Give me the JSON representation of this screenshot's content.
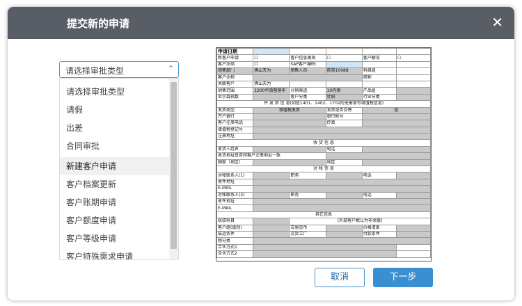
{
  "dialog": {
    "title": "提交新的申请",
    "close_icon": "close-icon",
    "close_glyph": "✕"
  },
  "approval_type": {
    "selected": "请选择审批类型",
    "caret": "⌃",
    "options": [
      "请选择审批类型",
      "请假",
      "出差",
      "合同审批",
      "新建客户申请",
      "客户档案更新",
      "客户账期申请",
      "客户额度申请",
      "客户等级申请",
      "客户特殊需求申请"
    ],
    "highlighted_index": 4
  },
  "form": {
    "r1": [
      "申请日期",
      "",
      "",
      "",
      "",
      ""
    ],
    "r2": [
      "新客户申请",
      "☐",
      "客户信息更改",
      "☐",
      "客户解冻",
      "☐"
    ],
    "r3": [
      "客户冻结",
      "☐",
      "SAP客户编码:",
      "",
      "",
      ""
    ],
    "r4": [
      "销售部门",
      "佛山天为",
      "销售人员",
      "陈奕10088",
      "科目组",
      ""
    ],
    "r5": [
      "客户全称",
      "",
      "",
      "",
      "简称",
      ""
    ],
    "r6": [
      "关联客户",
      "佛山天为",
      "",
      "",
      "",
      ""
    ],
    "r7": [
      "销售范围",
      "1200华南营销中",
      "分销渠道",
      "10内销",
      "产品组",
      ""
    ],
    "r8": [
      "尼尔森指数",
      "",
      "客户分类",
      "针织",
      "行业分类",
      ""
    ],
    "r9": "开 发 票 信 息(如是1401、1402、1702的无需填写增值税信息)",
    "r10": [
      "发票类型",
      "增值税发票",
      "发票是否交寄",
      "是"
    ],
    "r11": [
      "开户银行",
      "",
      "银行帐号",
      ""
    ],
    "r12": [
      "客户注册电话",
      "",
      "传真",
      ""
    ],
    "r13": [
      "增值税登记号",
      ""
    ],
    "r14": [
      "注册地址",
      ""
    ],
    "r15": "收 货 信 息",
    "r16": [
      "收货人姓名",
      "",
      "电话",
      ""
    ],
    "r17": [
      "收货地址是否和客户注册地址一致",
      ""
    ],
    "r18": [
      "国家（地区）",
      "",
      "地区",
      ""
    ],
    "r19": "对 帐 信 息",
    "r20": [
      "对帐联系人(1)",
      "",
      "职务",
      "",
      "电话",
      ""
    ],
    "r21": [
      "收件地址",
      ""
    ],
    "r22": [
      "E-MAIL",
      ""
    ],
    "r23": [
      "对帐联系人(2)",
      "",
      "职务",
      "",
      "电话",
      ""
    ],
    "r24": [
      "收件地址",
      ""
    ],
    "r25": [
      "E-MAIL",
      ""
    ],
    "r26": "其它信息",
    "r27": [
      "统驭科目",
      "",
      "(外部客户默认为非关联)"
    ],
    "r28": [
      "客户组(级别)",
      "",
      "交易货币",
      "",
      "价格清单",
      ""
    ],
    "r29": [
      "装运条件",
      "",
      "交货工厂",
      "",
      "付款条件",
      ""
    ],
    "r30": [
      "税分类",
      ""
    ],
    "r31": [
      "合伙方式1",
      ""
    ],
    "r32": [
      "合伙方式2",
      ""
    ]
  },
  "buttons": {
    "cancel": "取消",
    "next": "下一步"
  }
}
